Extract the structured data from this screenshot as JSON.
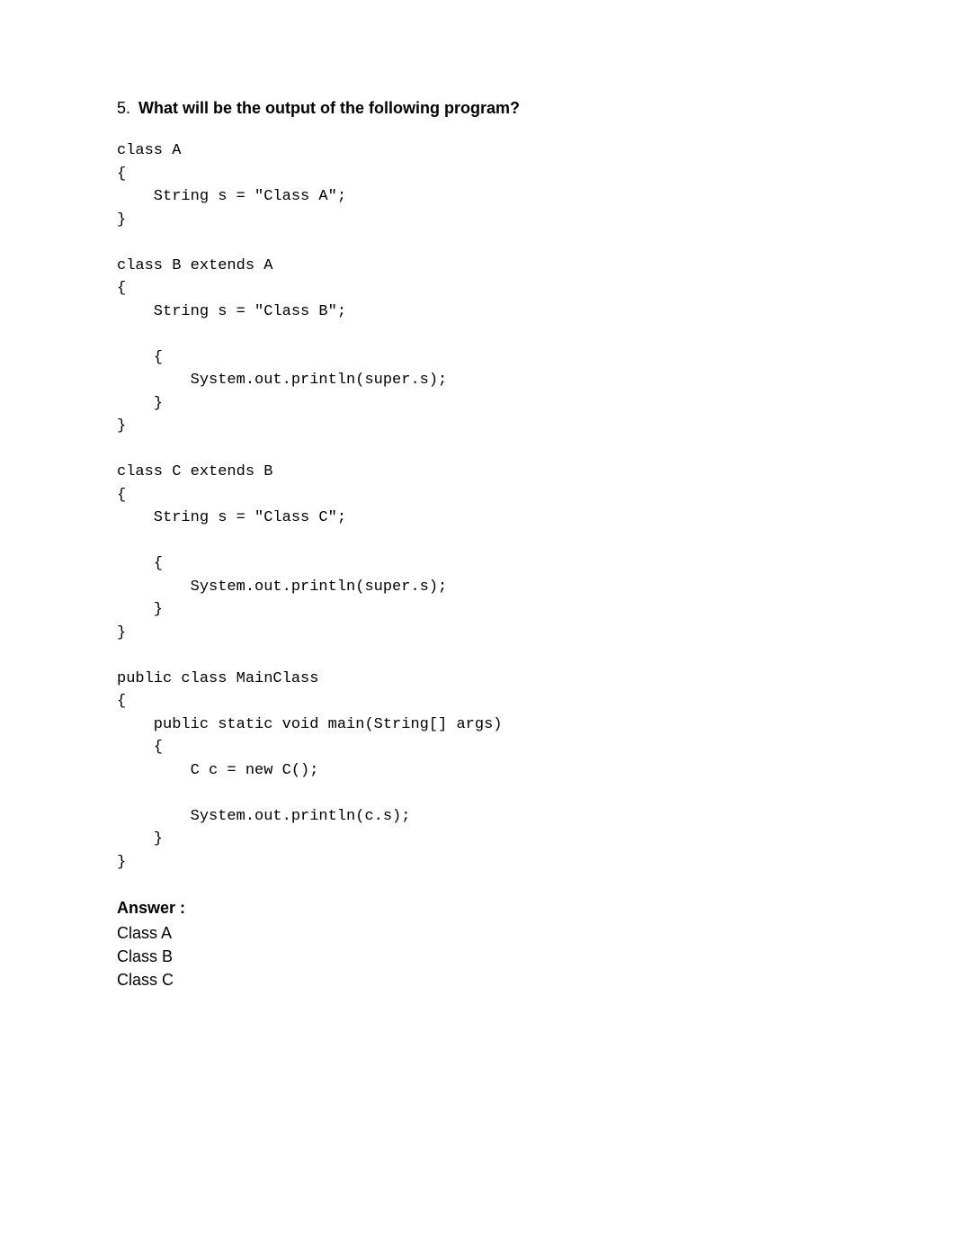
{
  "question": {
    "number": "5.",
    "text": "What will be the output of the following program?"
  },
  "code": "class A\n{\n    String s = \"Class A\";\n}\n \nclass B extends A\n{\n    String s = \"Class B\";\n \n    {\n        System.out.println(super.s);\n    }\n}\n \nclass C extends B\n{\n    String s = \"Class C\";\n \n    {\n        System.out.println(super.s);\n    }\n}\n \npublic class MainClass\n{\n    public static void main(String[] args)\n    {\n        C c = new C();\n \n        System.out.println(c.s);\n    }\n}",
  "answer": {
    "label": "Answer :",
    "lines": [
      "Class A",
      "Class B",
      "Class C"
    ]
  }
}
